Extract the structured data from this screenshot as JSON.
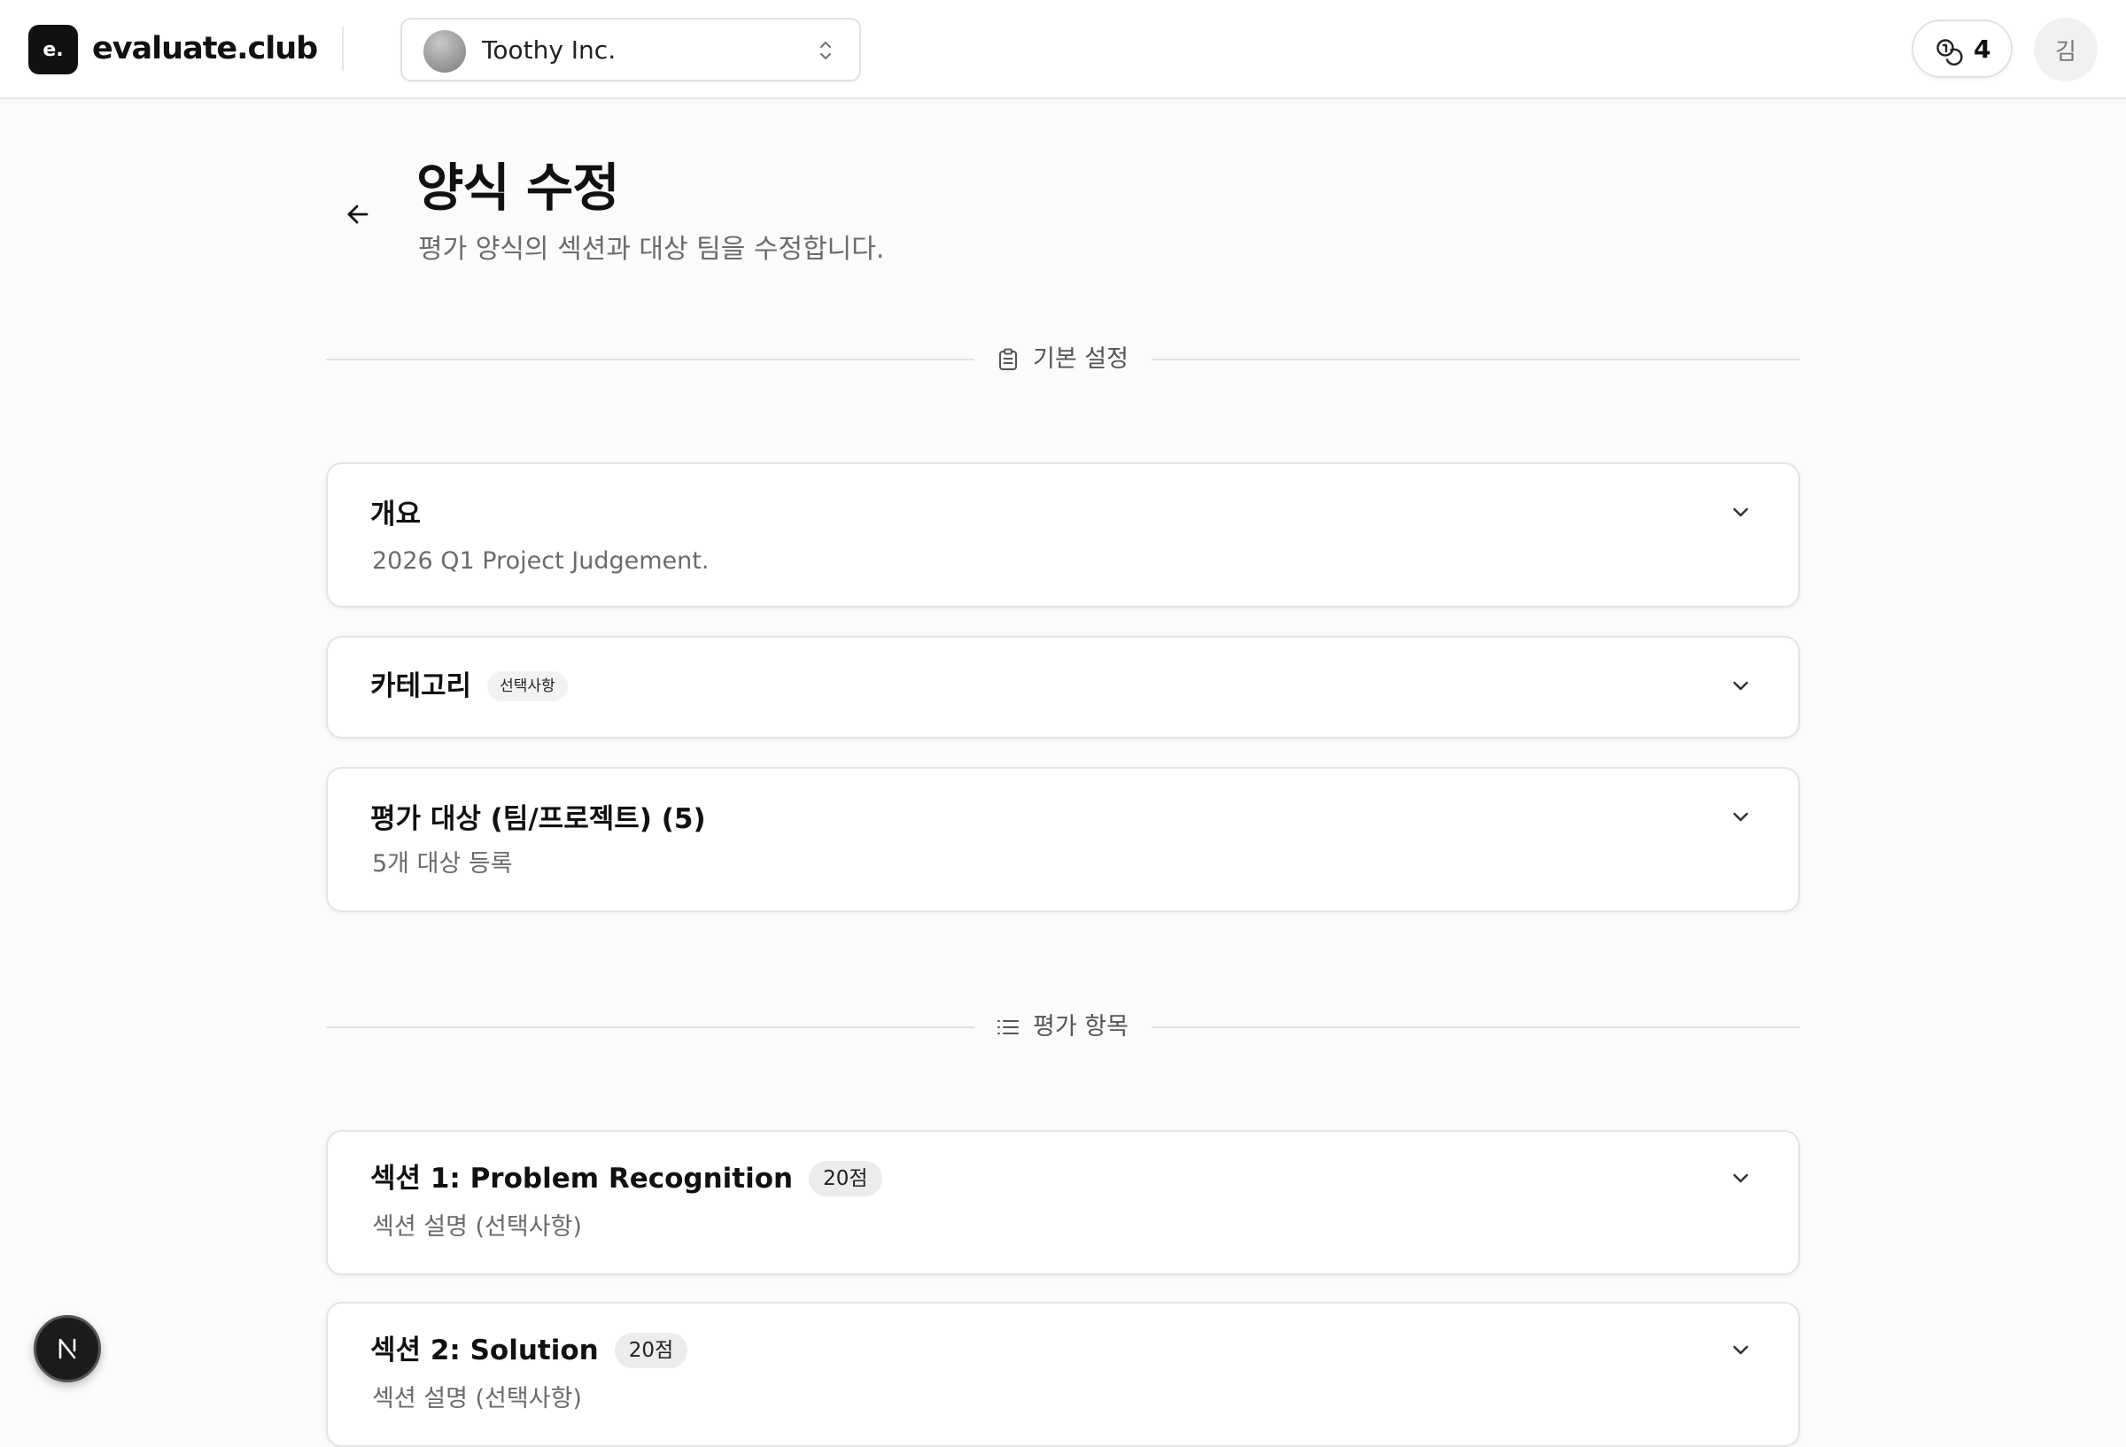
{
  "app": {
    "logo_mark": "e.",
    "brand": "evaluate.club"
  },
  "org_selector": {
    "name": "Toothy Inc.",
    "icon": "chevron-up-down-icon"
  },
  "header_right": {
    "count_icon": "coins-icon",
    "count": "4",
    "user_initial": "김"
  },
  "page": {
    "back_icon": "arrow-left-icon",
    "title": "양식 수정",
    "subtitle": "평가 양식의 섹션과 대상 팀을 수정합니다."
  },
  "basic_settings": {
    "icon": "clipboard-icon",
    "label": "기본 설정",
    "cards": [
      {
        "title": "개요",
        "description": "2026 Q1 Project Judgement."
      },
      {
        "title": "카테고리",
        "badge": "선택사항"
      },
      {
        "title": "평가 대상 (팀/프로젝트) (5)",
        "description": "5개 대상 등록"
      }
    ]
  },
  "evaluation_items": {
    "icon": "list-icon",
    "label": "평가 항목",
    "sections": [
      {
        "title": "섹션 1: Problem Recognition",
        "points": "20점",
        "description": "섹션 설명 (선택사항)"
      },
      {
        "title": "섹션 2: Solution",
        "points": "20점",
        "description": "섹션 설명 (선택사항)"
      }
    ]
  },
  "dev_tools": {
    "icon": "nextjs-logo-icon",
    "letter": "N"
  }
}
